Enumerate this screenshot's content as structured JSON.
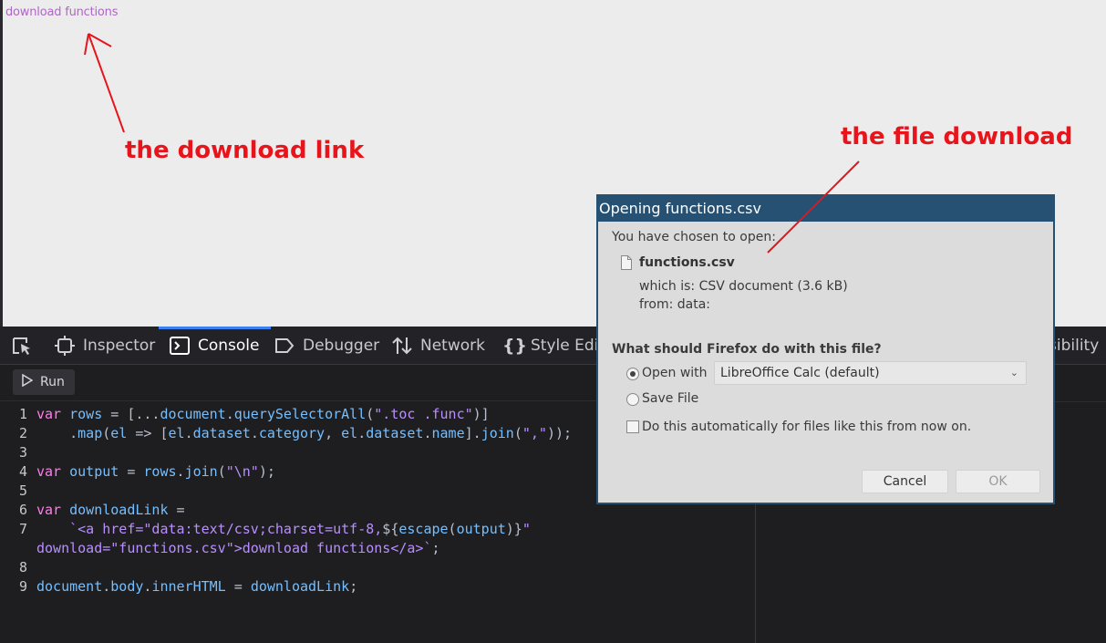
{
  "page": {
    "link_text": "download functions"
  },
  "annotations": {
    "download_link": "the download link",
    "file_download": "the file download",
    "color": "#e8141b"
  },
  "devtools": {
    "tabs": [
      {
        "label": "Inspector",
        "icon": "inspector-icon"
      },
      {
        "label": "Console",
        "icon": "console-icon",
        "active": true
      },
      {
        "label": "Debugger",
        "icon": "debugger-icon"
      },
      {
        "label": "Network",
        "icon": "network-icon"
      },
      {
        "label": "Style Edit",
        "icon": "style-editor-icon"
      }
    ],
    "truncated_tab": "sibility",
    "run_label": "Run",
    "code_lines": [
      "var rows = [...document.querySelectorAll(\".toc .func\")]",
      "    .map(el => [el.dataset.category, el.dataset.name].join(\",\"));",
      "",
      "var output = rows.join(\"\\n\");",
      "",
      "var downloadLink =",
      "    `<a href=\"data:text/csv;charset=utf-8,${escape(output)}\"",
      "download=\"functions.csv\">download functions</a>`;",
      "",
      "document.body.innerHTML = downloadLink;"
    ],
    "line_numbers": [
      "1",
      "2",
      "3",
      "4",
      "5",
      "6",
      "7",
      "",
      "8",
      "9"
    ]
  },
  "dialog": {
    "title": "Opening functions.csv",
    "intro": "You have chosen to open:",
    "filename": "functions.csv",
    "which_is": "which is: CSV document (3.6 kB)",
    "from": "from: data:",
    "question": "What should Firefox do with this file?",
    "open_with_label": "Open with",
    "open_with_app": "LibreOffice Calc (default)",
    "save_file_label": "Save File",
    "auto_label": "Do this automatically for files like this from now on.",
    "cancel_label": "Cancel",
    "ok_label": "OK"
  }
}
